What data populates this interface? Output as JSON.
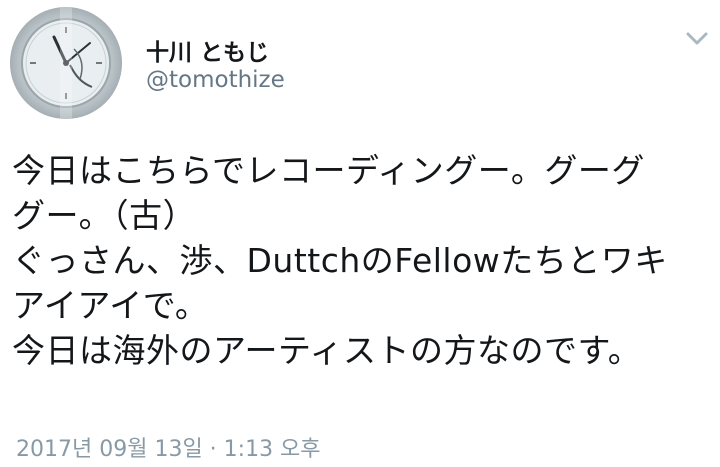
{
  "user": {
    "display_name": "十川 ともじ",
    "handle": "@tomothize",
    "avatar_icon": "clock-avatar"
  },
  "menu": {
    "icon": "chevron-down-icon"
  },
  "tweet": {
    "lines": [
      "今日はこちらでレコーディングー。グーグ",
      "グー。（古）",
      "ぐっさん、渉、DuttchのFellowたちとワキ",
      "アイアイで。",
      "今日は海外のアーティストの方なのです。"
    ],
    "timestamp": "2017년 09월 13일 · 1:13 오후"
  },
  "colors": {
    "text": "#14171a",
    "secondary": "#657786",
    "timestamp": "#8899a6",
    "chevron": "#aab8c2"
  }
}
